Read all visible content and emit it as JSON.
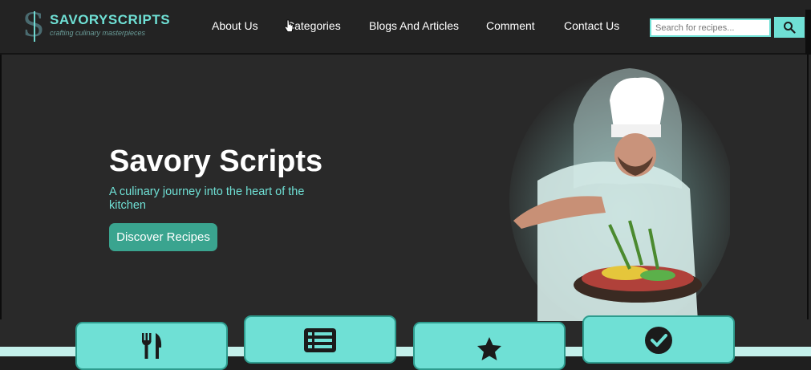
{
  "brand": {
    "name": "SAVORYSCRIPTS",
    "tagline": "crafting culinary masterpieces",
    "mark": "S"
  },
  "nav": {
    "items": [
      "About Us",
      "Categories",
      "Blogs And Articles",
      "Comment",
      "Contact Us"
    ]
  },
  "search": {
    "placeholder": "Search for recipes...",
    "icon": "search-icon"
  },
  "hero": {
    "title": "Savory Scripts",
    "subtitle": "A culinary journey into the heart of the kitchen",
    "cta_label": "Discover Recipes",
    "image": "chef-with-dish-image"
  },
  "feature_cards": [
    {
      "icon": "utensils-icon"
    },
    {
      "icon": "list-icon"
    },
    {
      "icon": "star-icon"
    },
    {
      "icon": "check-circle-icon"
    }
  ],
  "colors": {
    "accent": "#6fe0d5",
    "button": "#3aa48f",
    "background": "#292929",
    "header": "#232323"
  }
}
